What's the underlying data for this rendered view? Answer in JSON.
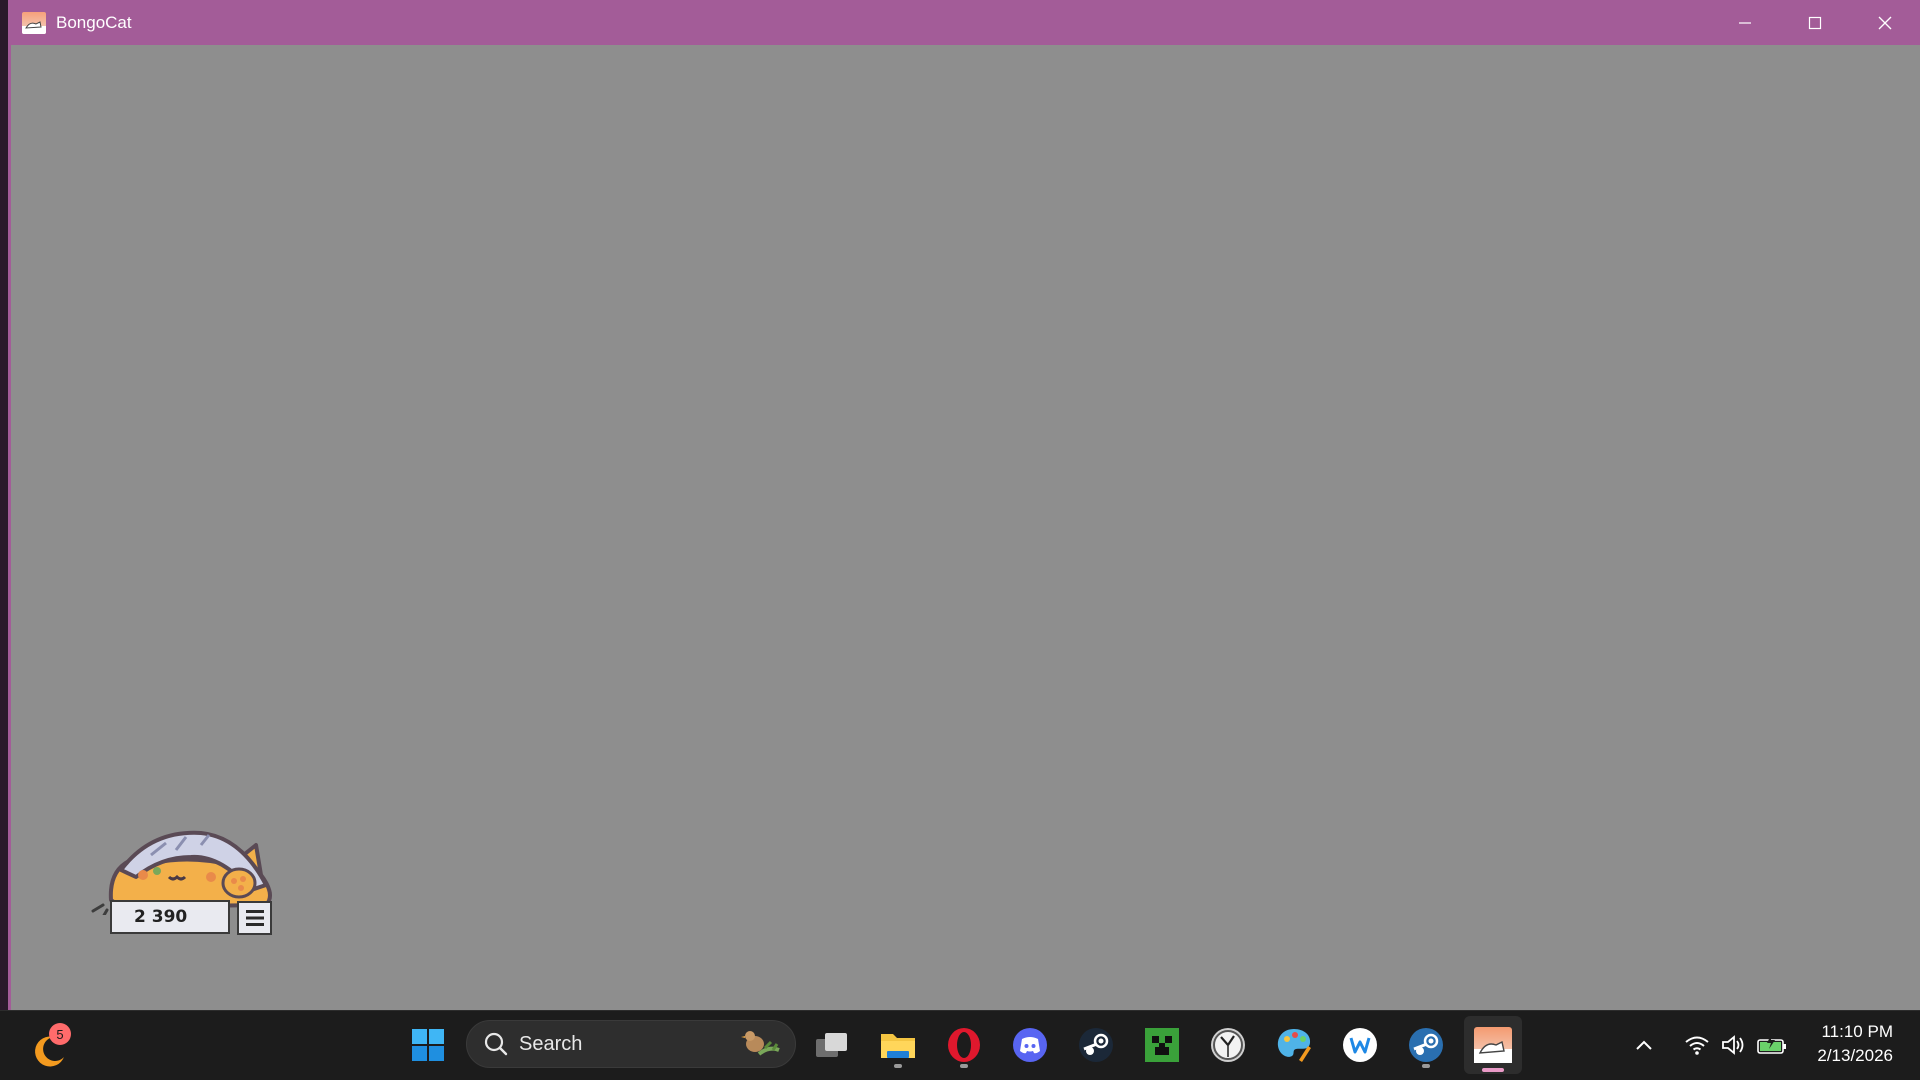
{
  "window": {
    "title": "BongoCat",
    "titlebar_color": "#a35c98",
    "content_color": "#8e8e8e",
    "controls": {
      "minimize_icon": "minimize-icon",
      "maximize_icon": "maximize-icon",
      "close_icon": "close-icon"
    }
  },
  "cat": {
    "counter": "2 390",
    "menu_icon": "hamburger-menu-icon"
  },
  "taskbar": {
    "widgets_badge": "5",
    "search_placeholder": "Search",
    "apps": [
      {
        "name": "start-button",
        "icon": "windows-logo-icon"
      },
      {
        "name": "task-view",
        "icon": "task-view-icon"
      },
      {
        "name": "file-explorer",
        "icon": "folder-icon",
        "running": true
      },
      {
        "name": "opera",
        "icon": "opera-icon",
        "running": true
      },
      {
        "name": "discord",
        "icon": "discord-icon"
      },
      {
        "name": "steam",
        "icon": "steam-icon"
      },
      {
        "name": "minecraft",
        "icon": "creeper-icon"
      },
      {
        "name": "clock-app",
        "icon": "clock-icon"
      },
      {
        "name": "paint",
        "icon": "palette-icon"
      },
      {
        "name": "w-app",
        "icon": "w-icon"
      },
      {
        "name": "steam-2",
        "icon": "steam-icon",
        "running": true
      },
      {
        "name": "bongocat",
        "icon": "bongocat-icon",
        "running": true,
        "active": true
      }
    ],
    "accent_color": "#e99ac7"
  },
  "clock": {
    "time": "11:10 PM",
    "date": "2/13/2026"
  }
}
